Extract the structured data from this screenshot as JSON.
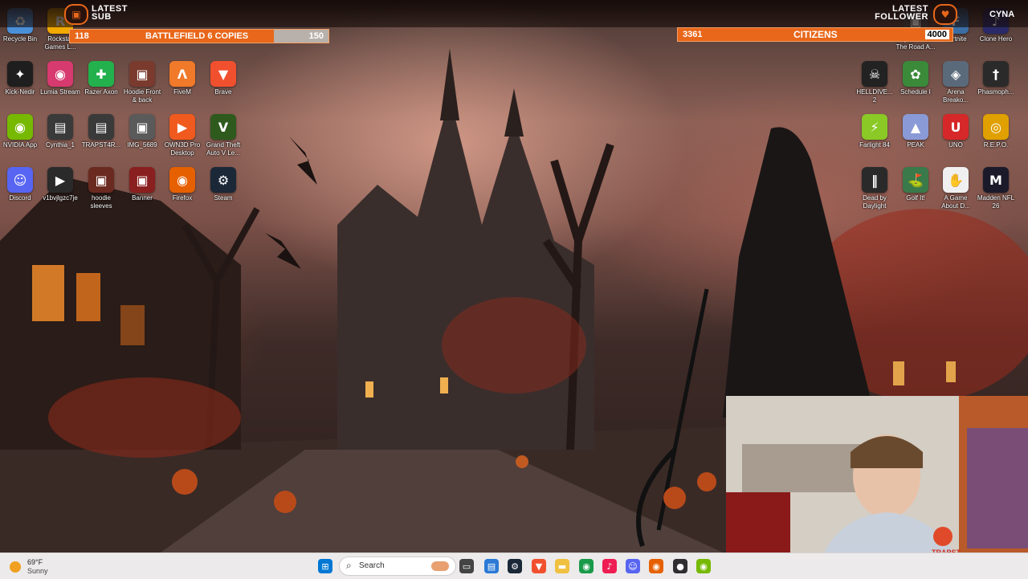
{
  "overlay": {
    "latest_sub_line1": "LATEST",
    "latest_sub_line2": "SUB",
    "latest_follower_line1": "LATEST",
    "latest_follower_line2": "FOLLOWER",
    "follower_tag": "CYNA",
    "goal_left": {
      "current": "118",
      "label": "BATTLEFIELD 6 COPIES",
      "target": "150",
      "progress": 0.79
    },
    "goal_right": {
      "current": "3361",
      "label": "CITIZENS",
      "target": "4000",
      "progress": 0.84
    }
  },
  "desktop_icons": [
    {
      "label": "Recycle Bin",
      "icon": "recycle-bin-icon",
      "color": "#4a90d9",
      "glyph": "♻"
    },
    {
      "label": "Rockstar Games L...",
      "icon": "rockstar-icon",
      "color": "#f2a900",
      "glyph": "R"
    },
    {
      "label": "Kick-Nedir",
      "icon": "kick-icon",
      "color": "#1e1e1e",
      "glyph": "✦"
    },
    {
      "label": "Lumia Stream",
      "icon": "lumia-icon",
      "color": "#d63a6e",
      "glyph": "◉"
    },
    {
      "label": "Razer Axon",
      "icon": "razer-axon-icon",
      "color": "#22b14c",
      "glyph": "✚"
    },
    {
      "label": "Hoodie Front & back",
      "icon": "image-file-icon",
      "color": "#7a3b2e",
      "glyph": "▣"
    },
    {
      "label": "FiveM",
      "icon": "fivem-icon",
      "color": "#f07a2a",
      "glyph": "Λ"
    },
    {
      "label": "Brave",
      "icon": "brave-icon",
      "color": "#f1502f",
      "glyph": "▼"
    },
    {
      "label": "NVIDIA App",
      "icon": "nvidia-icon",
      "color": "#76b900",
      "glyph": "◉"
    },
    {
      "label": "Cynthia_1",
      "icon": "video-file-icon",
      "color": "#3a3a3a",
      "glyph": "▤"
    },
    {
      "label": "TRAPST4R...",
      "icon": "video-file-icon",
      "color": "#3a3a3a",
      "glyph": "▤"
    },
    {
      "label": "IMG_5689",
      "icon": "image-file-icon",
      "color": "#5a5a5a",
      "glyph": "▣"
    },
    {
      "label": "OWN3D Pro Desktop",
      "icon": "own3d-icon",
      "color": "#f05a1e",
      "glyph": "▶"
    },
    {
      "label": "Grand Theft Auto V Le...",
      "icon": "gta-icon",
      "color": "#2f5a1e",
      "glyph": "V"
    },
    {
      "label": "Discord",
      "icon": "discord-icon",
      "color": "#5865f2",
      "glyph": "☺"
    },
    {
      "label": "v1bvjlgzc7je",
      "icon": "video-file-icon",
      "color": "#2a2a2a",
      "glyph": "▶"
    },
    {
      "label": "hoodie sleeves",
      "icon": "image-file-icon",
      "color": "#6a2a20",
      "glyph": "▣"
    },
    {
      "label": "Banner",
      "icon": "image-file-icon",
      "color": "#8a1f1f",
      "glyph": "▣"
    },
    {
      "label": "Firefox",
      "icon": "firefox-icon",
      "color": "#e66000",
      "glyph": "◉"
    },
    {
      "label": "Steam",
      "icon": "steam-icon",
      "color": "#1b2838",
      "glyph": "⚙"
    },
    {
      "label": "Quiet Pl... The Road A...",
      "icon": "game-icon",
      "color": "#4a4a4a",
      "glyph": "▣"
    },
    {
      "label": "Fortnite",
      "icon": "fortnite-icon",
      "color": "#3a6ea5",
      "glyph": "F"
    },
    {
      "label": "Clone Hero",
      "icon": "clone-hero-icon",
      "color": "#2a2a6a",
      "glyph": "♪"
    },
    {
      "label": "HELLDIVE... 2",
      "icon": "helldivers-icon",
      "color": "#222222",
      "glyph": "☠"
    },
    {
      "label": "Schedule I",
      "icon": "schedule-icon",
      "color": "#3a8a3a",
      "glyph": "✿"
    },
    {
      "label": "Arena Breako...",
      "icon": "arena-breakout-icon",
      "color": "#5a6a7a",
      "glyph": "◈"
    },
    {
      "label": "Phasmoph...",
      "icon": "phasmophobia-icon",
      "color": "#2a2a2a",
      "glyph": "†"
    },
    {
      "label": "Farlight 84",
      "icon": "farlight-icon",
      "color": "#8ac926",
      "glyph": "⚡"
    },
    {
      "label": "PEAK",
      "icon": "peak-icon",
      "color": "#8a9ad6",
      "glyph": "▲"
    },
    {
      "label": "UNO",
      "icon": "uno-icon",
      "color": "#d62828",
      "glyph": "U"
    },
    {
      "label": "R.E.P.O.",
      "icon": "repo-icon",
      "color": "#e0a000",
      "glyph": "◎"
    },
    {
      "label": "Dead by Daylight",
      "icon": "dbd-icon",
      "color": "#2a2a2a",
      "glyph": "‖"
    },
    {
      "label": "Golf It!",
      "icon": "golf-icon",
      "color": "#3a7a4a",
      "glyph": "⛳"
    },
    {
      "label": "A Game About D...",
      "icon": "game-icon",
      "color": "#f0f0f0",
      "glyph": "✋"
    },
    {
      "label": "Madden NFL 26",
      "icon": "madden-icon",
      "color": "#1a1a2a",
      "glyph": "M"
    }
  ],
  "taskbar": {
    "weather_temp": "69°F",
    "weather_desc": "Sunny",
    "search_placeholder": "Search"
  },
  "webcam_logo_text": "TRAPST"
}
